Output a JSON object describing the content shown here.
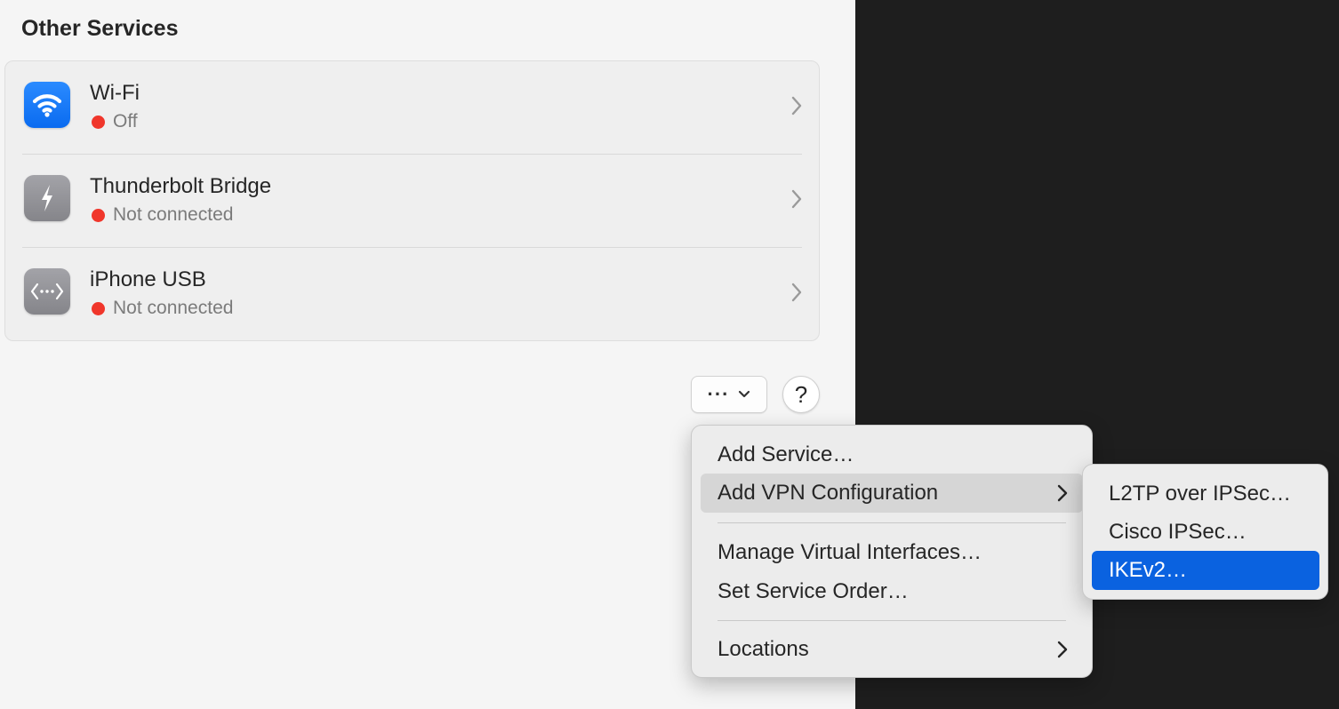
{
  "section": {
    "title": "Other Services"
  },
  "services": [
    {
      "name": "Wi-Fi",
      "status": "Off",
      "icon": "wifi-icon"
    },
    {
      "name": "Thunderbolt Bridge",
      "status": "Not connected",
      "icon": "thunderbolt-icon"
    },
    {
      "name": "iPhone USB",
      "status": "Not connected",
      "icon": "iphone-usb-icon"
    }
  ],
  "toolbar": {
    "action_label": "···",
    "help_label": "?"
  },
  "menu": {
    "add_service": "Add Service…",
    "add_vpn": "Add VPN Configuration",
    "manage_virtual": "Manage Virtual Interfaces…",
    "set_order": "Set Service Order…",
    "locations": "Locations"
  },
  "submenu": {
    "l2tp": "L2TP over IPSec…",
    "cisco": "Cisco IPSec…",
    "ikev2": "IKEv2…"
  },
  "colors": {
    "status_red": "#f0362b",
    "wifi_blue": "#0a6bf0",
    "selection_blue": "#0a62e0"
  }
}
